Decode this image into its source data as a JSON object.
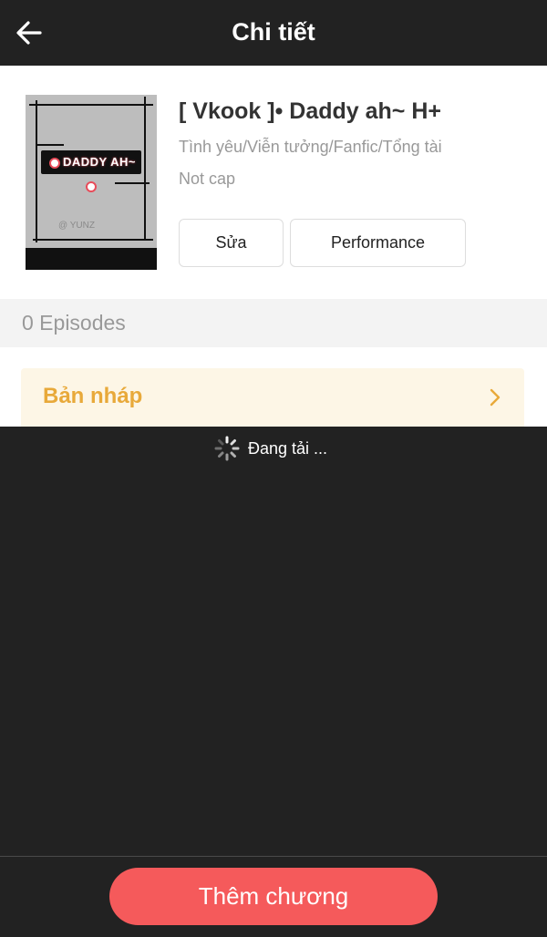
{
  "header": {
    "title": "Chi tiết",
    "back_icon": "arrow-left-icon"
  },
  "story": {
    "title": "[ Vkook ]• Daddy ah~ H+",
    "genres": "Tình yêu/Viễn tưởng/Fanfic/Tổng tài",
    "status": "Not cap",
    "cover": {
      "badge_text": "DADDY AH~",
      "signature": "@ YUNZ"
    }
  },
  "actions": {
    "edit_label": "Sửa",
    "performance_label": "Performance"
  },
  "episodes": {
    "label": "0 Episodes"
  },
  "draft": {
    "label": "Bản nháp",
    "chevron_icon": "chevron-right-icon"
  },
  "loading": {
    "text": "Đang tải ..."
  },
  "footer": {
    "add_chapter_label": "Thêm chương"
  },
  "colors": {
    "header_bg": "#222222",
    "accent": "#f55a5b",
    "draft_text": "#e8a93a",
    "draft_bg": "#fdf6e6"
  }
}
